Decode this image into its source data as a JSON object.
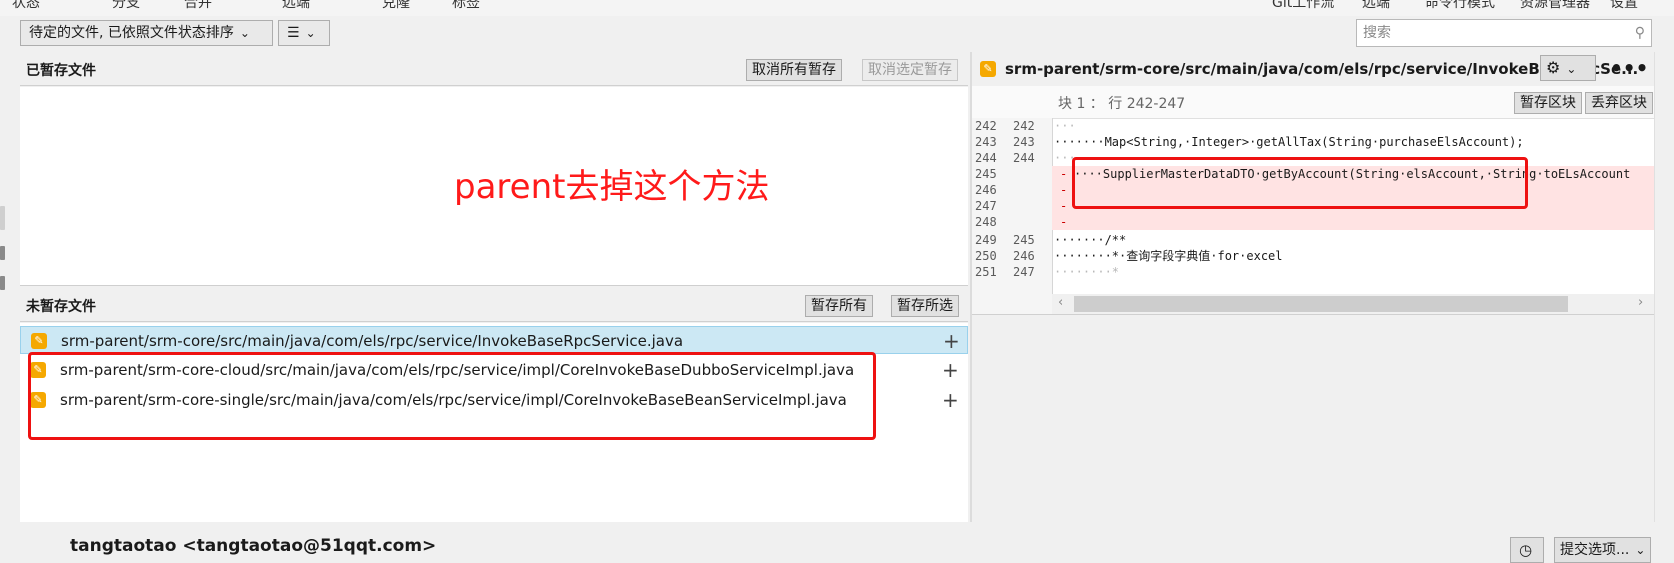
{
  "menu": {
    "items": [
      "状态",
      "分支",
      "合并",
      "远端",
      "克隆",
      "标签",
      "Git工作流",
      "远端",
      "命令行模式",
      "资源管理器",
      "设置"
    ]
  },
  "toolbar": {
    "filter_dropdown": "待定的文件, 已依照文件状态排序",
    "view_dropdown_icon": "list-icon",
    "search_placeholder": "搜索"
  },
  "staged": {
    "title": "已暂存文件",
    "unstage_all_label": "取消所有暂存",
    "unstage_selected_label": "取消选定暂存",
    "annotation": "parent去掉这个方法"
  },
  "unstaged": {
    "title": "未暂存文件",
    "stage_all_label": "暂存所有",
    "stage_selected_label": "暂存所选",
    "files": [
      {
        "path": "srm-parent/srm-core/src/main/java/com/els/rpc/service/InvokeBaseRpcService.java",
        "selected": true
      },
      {
        "path": "srm-parent/srm-core-cloud/src/main/java/com/els/rpc/service/impl/CoreInvokeBaseDubboServiceImpl.java",
        "selected": false
      },
      {
        "path": "srm-parent/srm-core-single/src/main/java/com/els/rpc/service/impl/CoreInvokeBaseBeanServiceImpl.java",
        "selected": false
      }
    ]
  },
  "diff": {
    "file_title": "srm-parent/srm-core/src/main/java/com/els/rpc/service/InvokeBaseRpcSe...",
    "hunk_label": "块 1 ： 行 242-247",
    "stage_hunk_label": "暂存区块",
    "discard_hunk_label": "丢弃区块",
    "lines": [
      {
        "old": "242",
        "new": "242",
        "marker": "",
        "text": "···"
      },
      {
        "old": "243",
        "new": "243",
        "marker": "",
        "text": "·······Map<String,·Integer>·getAllTax(String·purchaseElsAccount);"
      },
      {
        "old": "244",
        "new": "244",
        "marker": "",
        "text": "···"
      },
      {
        "old": "245",
        "new": "",
        "marker": "-",
        "text": "····SupplierMasterDataDTO·getByAccount(String·elsAccount,·String·toELsAccount"
      },
      {
        "old": "246",
        "new": "",
        "marker": "-",
        "text": ""
      },
      {
        "old": "247",
        "new": "",
        "marker": "-",
        "text": ""
      },
      {
        "old": "248",
        "new": "",
        "marker": "-",
        "text": ""
      },
      {
        "old": "249",
        "new": "245",
        "marker": "",
        "text": "·······/**"
      },
      {
        "old": "250",
        "new": "246",
        "marker": "",
        "text": "········*·查询字段字典值·for·excel"
      },
      {
        "old": "251",
        "new": "247",
        "marker": "",
        "text": "········*"
      }
    ]
  },
  "footer": {
    "author": "tangtaotao <tangtaotao@51qqt.com>",
    "commit_options_label": "提交选项..."
  },
  "colors": {
    "highlight_box": "#ee1111",
    "annotation_text": "#ff1a1a",
    "selected_row": "#cce8f4",
    "removed_line": "#ffe3e3",
    "file_modified_icon": "#f5a800"
  }
}
